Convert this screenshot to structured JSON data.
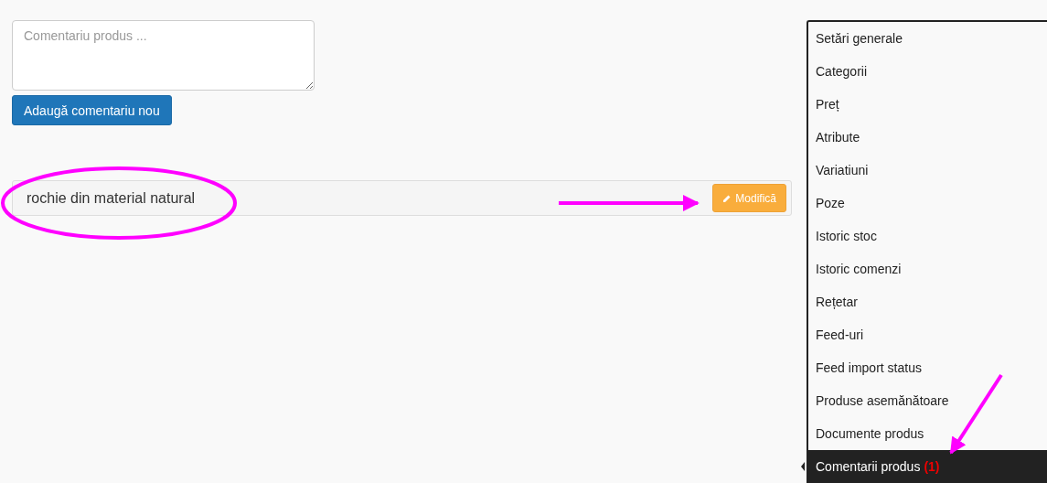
{
  "comment_form": {
    "placeholder": "Comentariu produs ...",
    "submit_button": "Adaugă comentariu nou"
  },
  "comments": [
    {
      "text": "rochie din material natural",
      "edit_button": "Modifică"
    }
  ],
  "sidebar": {
    "items": [
      {
        "label": "Setări generale",
        "selected": false
      },
      {
        "label": "Categorii",
        "selected": false
      },
      {
        "label": "Preț",
        "selected": false
      },
      {
        "label": "Atribute",
        "selected": false
      },
      {
        "label": "Variatiuni",
        "selected": false
      },
      {
        "label": "Poze",
        "selected": false
      },
      {
        "label": "Istoric stoc",
        "selected": false
      },
      {
        "label": "Istoric comenzi",
        "selected": false
      },
      {
        "label": "Rețetar",
        "selected": false
      },
      {
        "label": "Feed-uri",
        "selected": false
      },
      {
        "label": "Feed import status",
        "selected": false
      },
      {
        "label": "Produse asemănătoare",
        "selected": false
      },
      {
        "label": "Documente produs",
        "selected": false
      },
      {
        "label": "Comentarii produs",
        "count": "(1)",
        "selected": true
      }
    ]
  }
}
